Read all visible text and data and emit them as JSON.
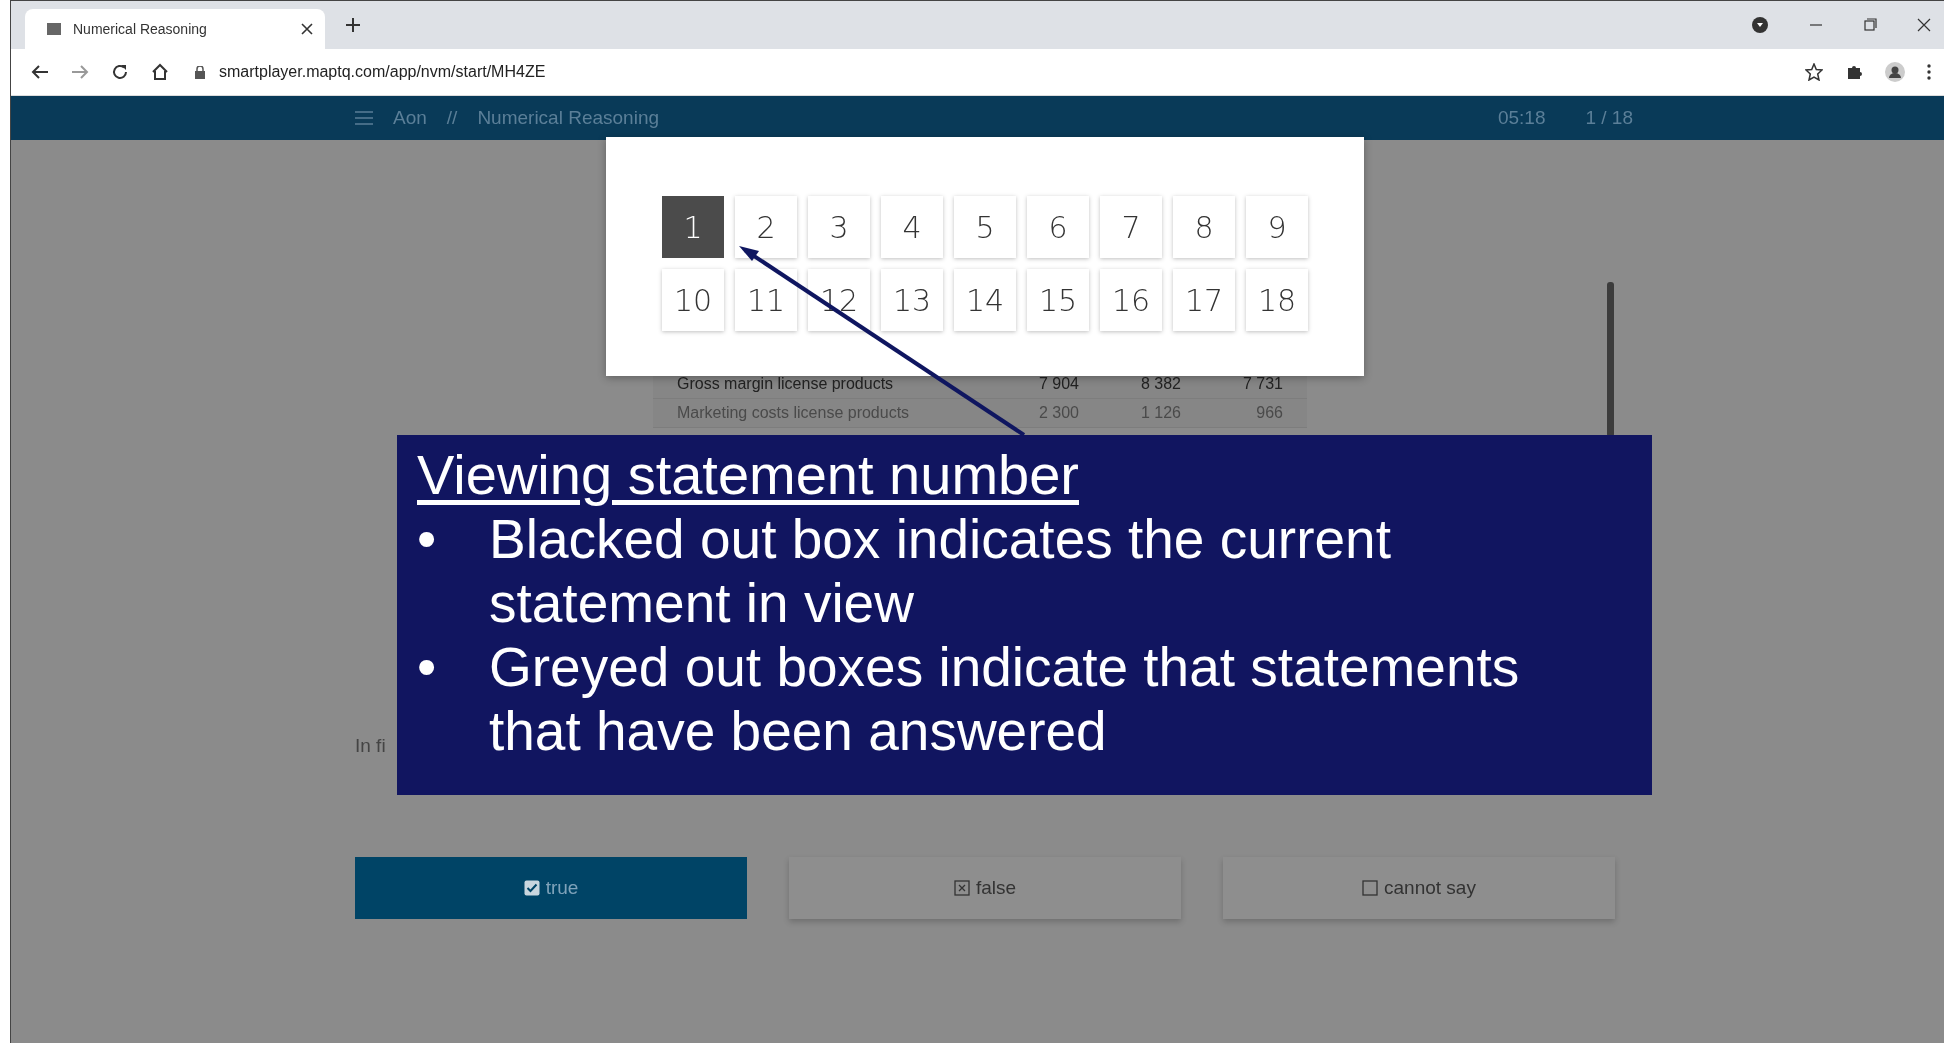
{
  "browser": {
    "tab_title": "Numerical Reasoning",
    "url": "smartplayer.maptq.com/app/nvm/start/MH4ZE"
  },
  "app_header": {
    "brand": "Aon",
    "separator": "//",
    "title": "Numerical Reasoning",
    "timer": "05:18",
    "progress": "1 / 18"
  },
  "table": {
    "rows": [
      {
        "label": "Gross margin license products",
        "bold": true,
        "values": [
          "7 904",
          "8 382",
          "7 731"
        ]
      },
      {
        "label": "Marketing costs license products",
        "bold": false,
        "values": [
          "2 300",
          "1 126",
          "966"
        ]
      }
    ]
  },
  "question_text": "In fi",
  "statement_picker": {
    "items": [
      {
        "label": "1",
        "selected": true
      },
      {
        "label": "2",
        "selected": false
      },
      {
        "label": "3",
        "selected": false
      },
      {
        "label": "4",
        "selected": false
      },
      {
        "label": "5",
        "selected": false
      },
      {
        "label": "6",
        "selected": false
      },
      {
        "label": "7",
        "selected": false
      },
      {
        "label": "8",
        "selected": false
      },
      {
        "label": "9",
        "selected": false
      },
      {
        "label": "10",
        "selected": false
      },
      {
        "label": "11",
        "selected": false
      },
      {
        "label": "12",
        "selected": false
      },
      {
        "label": "13",
        "selected": false
      },
      {
        "label": "14",
        "selected": false
      },
      {
        "label": "15",
        "selected": false
      },
      {
        "label": "16",
        "selected": false
      },
      {
        "label": "17",
        "selected": false
      },
      {
        "label": "18",
        "selected": false
      }
    ]
  },
  "answers": [
    {
      "label": "true",
      "kind": "check",
      "selected": true
    },
    {
      "label": "false",
      "kind": "cross",
      "selected": false
    },
    {
      "label": "cannot say",
      "kind": "empty",
      "selected": false
    }
  ],
  "callout": {
    "heading": "Viewing statement number",
    "bullets": [
      {
        "marker": "•",
        "text": "Blacked out box indicates the current statement in view"
      },
      {
        "marker": "•",
        "text": "Greyed out boxes indicate that statements that have been answered"
      }
    ]
  }
}
